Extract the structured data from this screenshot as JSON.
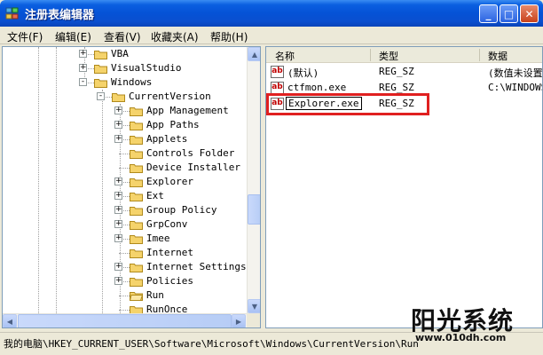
{
  "window": {
    "title": "注册表编辑器",
    "buttons": {
      "minimize": "_",
      "maximize": "□",
      "close": "✕"
    }
  },
  "menu": [
    {
      "label": "文件(F)"
    },
    {
      "label": "编辑(E)"
    },
    {
      "label": "查看(V)"
    },
    {
      "label": "收藏夹(A)"
    },
    {
      "label": "帮助(H)"
    }
  ],
  "tree": [
    {
      "label": "VBA",
      "expander": "+",
      "level": 0
    },
    {
      "label": "VisualStudio",
      "expander": "+",
      "level": 0
    },
    {
      "label": "Windows",
      "expander": "-",
      "level": 0
    },
    {
      "label": "CurrentVersion",
      "expander": "-",
      "level": 1
    },
    {
      "label": "App Management",
      "expander": "+",
      "level": 2
    },
    {
      "label": "App Paths",
      "expander": "+",
      "level": 2
    },
    {
      "label": "Applets",
      "expander": "+",
      "level": 2
    },
    {
      "label": "Controls Folder",
      "expander": "",
      "level": 2
    },
    {
      "label": "Device Installer",
      "expander": "",
      "level": 2
    },
    {
      "label": "Explorer",
      "expander": "+",
      "level": 2
    },
    {
      "label": "Ext",
      "expander": "+",
      "level": 2
    },
    {
      "label": "Group Policy",
      "expander": "+",
      "level": 2
    },
    {
      "label": "GrpConv",
      "expander": "+",
      "level": 2
    },
    {
      "label": "Imee",
      "expander": "+",
      "level": 2
    },
    {
      "label": "Internet",
      "expander": "",
      "level": 2
    },
    {
      "label": "Internet Settings",
      "expander": "+",
      "level": 2
    },
    {
      "label": "Policies",
      "expander": "+",
      "level": 2
    },
    {
      "label": "Run",
      "expander": "",
      "level": 2,
      "open": true
    },
    {
      "label": "RunOnce",
      "expander": "",
      "level": 2
    }
  ],
  "list": {
    "columns": [
      "名称",
      "类型",
      "数据"
    ],
    "rows": [
      {
        "icon": "ab",
        "name": "(默认)",
        "type": "REG_SZ",
        "data": "(数值未设置"
      },
      {
        "icon": "ab",
        "name": "ctfmon.exe",
        "type": "REG_SZ",
        "data": "C:\\WINDOWS"
      },
      {
        "icon": "ab",
        "name": "Explorer.exe",
        "type": "REG_SZ",
        "data": "",
        "editing": true
      }
    ]
  },
  "scrollbar": {
    "up": "▲",
    "down": "▼",
    "left": "◀",
    "right": "▶"
  },
  "status": {
    "path": "我的电脑\\HKEY_CURRENT_USER\\Software\\Microsoft\\Windows\\CurrentVersion\\Run"
  },
  "watermark": {
    "name": "阳光系统",
    "url": "www.010dh.com"
  },
  "colors": {
    "titlebar": "#0552d6",
    "highlight": "#e02020",
    "folder": "#f5d36b"
  }
}
